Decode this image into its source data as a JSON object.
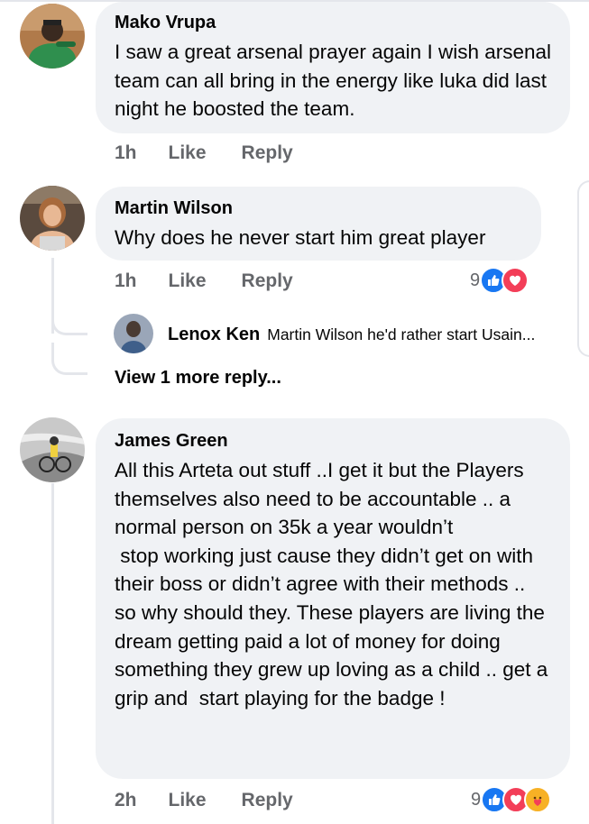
{
  "comments": [
    {
      "author": "Mako Vrupa",
      "text": "I saw a great arsenal prayer again I wish arsenal team can all bring in the energy like luka did last night he boosted the team.",
      "time": "1h",
      "like": "Like",
      "reply": "Reply"
    },
    {
      "author": "Martin Wilson",
      "text": "Why does he never start him great player",
      "time": "1h",
      "like": "Like",
      "reply": "Reply",
      "reaction_count": "9",
      "reactions": [
        "like-reaction-icon",
        "love-reaction-icon"
      ],
      "replies": [
        {
          "author": "Lenox Ken",
          "text": "Martin Wilson he'd rather start Usain..."
        }
      ],
      "view_more": "View 1 more reply..."
    },
    {
      "author": "James Green",
      "text": "All this Arteta out stuff ..I get it but the Players themselves also need to be accountable .. a normal person on 35k a year wouldn’t\n stop working just cause they didn’t get on with their boss or didn’t agree with their methods .. so why should they. These players are living the dream getting paid a lot of money for doing something they grew up loving as a child .. get a grip and  start playing for the badge !",
      "time": "2h",
      "like": "Like",
      "reply": "Reply",
      "reaction_count": "9",
      "reactions": [
        "like-reaction-icon",
        "love-reaction-icon",
        "care-reaction-icon"
      ]
    }
  ],
  "colors": {
    "bubble": "#f0f2f5",
    "meta_text": "#65676b",
    "like_blue": "#1877f2",
    "love_red": "#f33e58",
    "care_yellow": "#f7b125"
  }
}
